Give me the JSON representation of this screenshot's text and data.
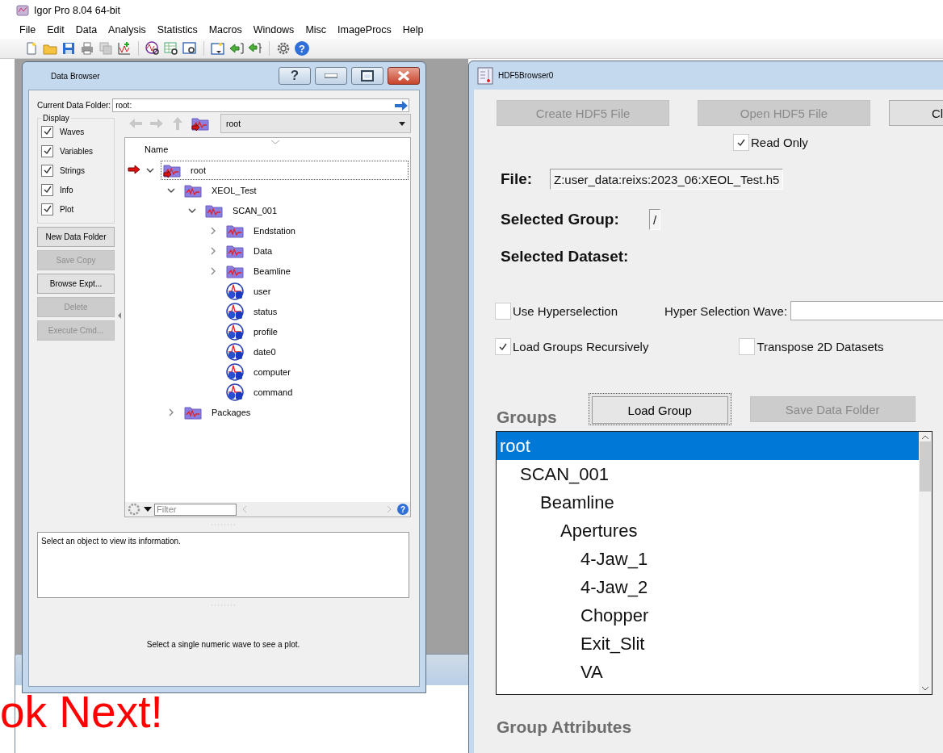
{
  "app": {
    "title": "Igor Pro 8.04 64-bit",
    "menu": [
      "File",
      "Edit",
      "Data",
      "Analysis",
      "Statistics",
      "Macros",
      "Windows",
      "Misc",
      "ImageProcs",
      "Help"
    ],
    "help_glyph": "?"
  },
  "data_browser": {
    "title": "Data Browser",
    "help_glyph": "?",
    "current_folder_label": "Current Data Folder:",
    "current_folder": "root:",
    "display": {
      "title": "Display",
      "options": [
        {
          "label": "Waves",
          "checked": true
        },
        {
          "label": "Variables",
          "checked": true
        },
        {
          "label": "Strings",
          "checked": true
        },
        {
          "label": "Info",
          "checked": true
        },
        {
          "label": "Plot",
          "checked": true
        }
      ]
    },
    "buttons": [
      {
        "label": "New Data Folder",
        "disabled": false
      },
      {
        "label": "Save Copy",
        "disabled": true
      },
      {
        "label": "Browse Expt...",
        "disabled": false
      },
      {
        "label": "Delete",
        "disabled": true
      },
      {
        "label": "Execute Cmd...",
        "disabled": true
      }
    ],
    "folder_dropdown": "root",
    "tree": {
      "header": "Name",
      "items": [
        {
          "label": "root",
          "kind": "folder",
          "expanded": true,
          "selected": true,
          "current": true,
          "children": [
            {
              "label": "XEOL_Test",
              "kind": "folder",
              "expanded": true,
              "selected": false,
              "current": false,
              "children": [
                {
                  "label": "SCAN_001",
                  "kind": "folder",
                  "expanded": true,
                  "selected": false,
                  "current": false,
                  "children": [
                    {
                      "label": "Endstation",
                      "kind": "folder",
                      "expanded": false,
                      "selected": false,
                      "current": false
                    },
                    {
                      "label": "Data",
                      "kind": "folder",
                      "expanded": false,
                      "selected": false,
                      "current": false
                    },
                    {
                      "label": "Beamline",
                      "kind": "folder",
                      "expanded": false,
                      "selected": false,
                      "current": false
                    },
                    {
                      "label": "user",
                      "kind": "string",
                      "selected": false,
                      "current": false
                    },
                    {
                      "label": "status",
                      "kind": "string",
                      "selected": false,
                      "current": false
                    },
                    {
                      "label": "profile",
                      "kind": "string",
                      "selected": false,
                      "current": false
                    },
                    {
                      "label": "date0",
                      "kind": "string",
                      "selected": false,
                      "current": false
                    },
                    {
                      "label": "computer",
                      "kind": "string",
                      "selected": false,
                      "current": false
                    },
                    {
                      "label": "command",
                      "kind": "string",
                      "selected": false,
                      "current": false
                    }
                  ]
                }
              ]
            },
            {
              "label": "Packages",
              "kind": "folder",
              "expanded": false,
              "selected": false,
              "current": false
            }
          ]
        }
      ]
    },
    "filter": {
      "placeholder": "Filter"
    },
    "info_text": "Select an object to view its information.",
    "plot_text": "Select a single numeric wave to see a plot."
  },
  "hdf5_browser": {
    "title": "HDF5Browser0",
    "buttons": [
      {
        "label": "Create HDF5 File",
        "disabled": true
      },
      {
        "label": "Open HDF5 File",
        "disabled": true
      },
      {
        "label": "Cl",
        "disabled": false
      }
    ],
    "read_only": {
      "label": "Read Only",
      "checked": true
    },
    "file": {
      "label": "File:",
      "value": "Z:user_data:reixs:2023_06:XEOL_Test.h5"
    },
    "selected_group": {
      "label": "Selected Group:",
      "value": "/"
    },
    "selected_dataset": {
      "label": "Selected Dataset:"
    },
    "use_hyperselection": {
      "label": "Use Hyperselection",
      "checked": false
    },
    "hyper_selection_wave": {
      "label": "Hyper Selection Wave:"
    },
    "load_groups_recursively": {
      "label": "Load Groups Recursively",
      "checked": true
    },
    "transpose_2d": {
      "label": "Transpose 2D Datasets",
      "checked": false
    },
    "groups": {
      "title": "Groups",
      "load_button": {
        "label": "Load Group",
        "disabled": false
      },
      "save_button": {
        "label": "Save Data Folder",
        "disabled": true
      },
      "items": [
        {
          "label": "root",
          "selected": true,
          "children": [
            {
              "label": "SCAN_001",
              "selected": false,
              "children": [
                {
                  "label": "Beamline",
                  "selected": false,
                  "children": [
                    {
                      "label": "Apertures",
                      "selected": false,
                      "children": [
                        {
                          "label": "4-Jaw_1",
                          "selected": false
                        },
                        {
                          "label": "4-Jaw_2",
                          "selected": false
                        },
                        {
                          "label": "Chopper",
                          "selected": false
                        },
                        {
                          "label": "Exit_Slit",
                          "selected": false
                        },
                        {
                          "label": "VA",
                          "selected": false
                        }
                      ]
                    }
                  ]
                }
              ]
            }
          ]
        }
      ]
    },
    "group_attributes_title": "Group Attributes"
  },
  "annotation": "ok Next!"
}
